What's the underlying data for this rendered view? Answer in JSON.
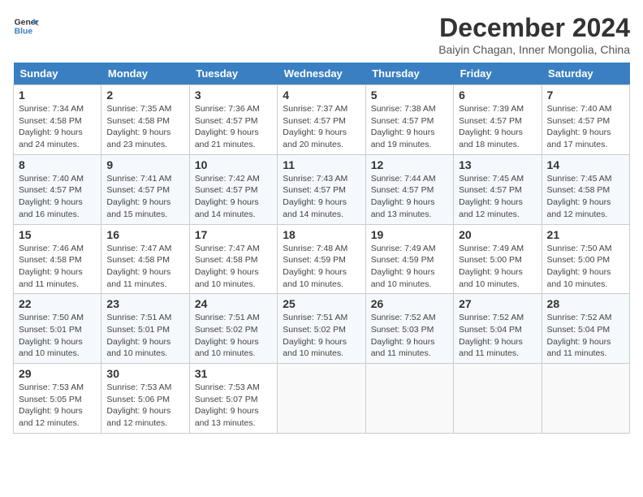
{
  "logo": {
    "line1": "General",
    "line2": "Blue"
  },
  "title": "December 2024",
  "subtitle": "Baiyin Chagan, Inner Mongolia, China",
  "days_of_week": [
    "Sunday",
    "Monday",
    "Tuesday",
    "Wednesday",
    "Thursday",
    "Friday",
    "Saturday"
  ],
  "weeks": [
    [
      {
        "day": 1,
        "sunrise": "Sunrise: 7:34 AM",
        "sunset": "Sunset: 4:58 PM",
        "daylight": "Daylight: 9 hours and 24 minutes."
      },
      {
        "day": 2,
        "sunrise": "Sunrise: 7:35 AM",
        "sunset": "Sunset: 4:58 PM",
        "daylight": "Daylight: 9 hours and 23 minutes."
      },
      {
        "day": 3,
        "sunrise": "Sunrise: 7:36 AM",
        "sunset": "Sunset: 4:57 PM",
        "daylight": "Daylight: 9 hours and 21 minutes."
      },
      {
        "day": 4,
        "sunrise": "Sunrise: 7:37 AM",
        "sunset": "Sunset: 4:57 PM",
        "daylight": "Daylight: 9 hours and 20 minutes."
      },
      {
        "day": 5,
        "sunrise": "Sunrise: 7:38 AM",
        "sunset": "Sunset: 4:57 PM",
        "daylight": "Daylight: 9 hours and 19 minutes."
      },
      {
        "day": 6,
        "sunrise": "Sunrise: 7:39 AM",
        "sunset": "Sunset: 4:57 PM",
        "daylight": "Daylight: 9 hours and 18 minutes."
      },
      {
        "day": 7,
        "sunrise": "Sunrise: 7:40 AM",
        "sunset": "Sunset: 4:57 PM",
        "daylight": "Daylight: 9 hours and 17 minutes."
      }
    ],
    [
      {
        "day": 8,
        "sunrise": "Sunrise: 7:40 AM",
        "sunset": "Sunset: 4:57 PM",
        "daylight": "Daylight: 9 hours and 16 minutes."
      },
      {
        "day": 9,
        "sunrise": "Sunrise: 7:41 AM",
        "sunset": "Sunset: 4:57 PM",
        "daylight": "Daylight: 9 hours and 15 minutes."
      },
      {
        "day": 10,
        "sunrise": "Sunrise: 7:42 AM",
        "sunset": "Sunset: 4:57 PM",
        "daylight": "Daylight: 9 hours and 14 minutes."
      },
      {
        "day": 11,
        "sunrise": "Sunrise: 7:43 AM",
        "sunset": "Sunset: 4:57 PM",
        "daylight": "Daylight: 9 hours and 14 minutes."
      },
      {
        "day": 12,
        "sunrise": "Sunrise: 7:44 AM",
        "sunset": "Sunset: 4:57 PM",
        "daylight": "Daylight: 9 hours and 13 minutes."
      },
      {
        "day": 13,
        "sunrise": "Sunrise: 7:45 AM",
        "sunset": "Sunset: 4:57 PM",
        "daylight": "Daylight: 9 hours and 12 minutes."
      },
      {
        "day": 14,
        "sunrise": "Sunrise: 7:45 AM",
        "sunset": "Sunset: 4:58 PM",
        "daylight": "Daylight: 9 hours and 12 minutes."
      }
    ],
    [
      {
        "day": 15,
        "sunrise": "Sunrise: 7:46 AM",
        "sunset": "Sunset: 4:58 PM",
        "daylight": "Daylight: 9 hours and 11 minutes."
      },
      {
        "day": 16,
        "sunrise": "Sunrise: 7:47 AM",
        "sunset": "Sunset: 4:58 PM",
        "daylight": "Daylight: 9 hours and 11 minutes."
      },
      {
        "day": 17,
        "sunrise": "Sunrise: 7:47 AM",
        "sunset": "Sunset: 4:58 PM",
        "daylight": "Daylight: 9 hours and 10 minutes."
      },
      {
        "day": 18,
        "sunrise": "Sunrise: 7:48 AM",
        "sunset": "Sunset: 4:59 PM",
        "daylight": "Daylight: 9 hours and 10 minutes."
      },
      {
        "day": 19,
        "sunrise": "Sunrise: 7:49 AM",
        "sunset": "Sunset: 4:59 PM",
        "daylight": "Daylight: 9 hours and 10 minutes."
      },
      {
        "day": 20,
        "sunrise": "Sunrise: 7:49 AM",
        "sunset": "Sunset: 5:00 PM",
        "daylight": "Daylight: 9 hours and 10 minutes."
      },
      {
        "day": 21,
        "sunrise": "Sunrise: 7:50 AM",
        "sunset": "Sunset: 5:00 PM",
        "daylight": "Daylight: 9 hours and 10 minutes."
      }
    ],
    [
      {
        "day": 22,
        "sunrise": "Sunrise: 7:50 AM",
        "sunset": "Sunset: 5:01 PM",
        "daylight": "Daylight: 9 hours and 10 minutes."
      },
      {
        "day": 23,
        "sunrise": "Sunrise: 7:51 AM",
        "sunset": "Sunset: 5:01 PM",
        "daylight": "Daylight: 9 hours and 10 minutes."
      },
      {
        "day": 24,
        "sunrise": "Sunrise: 7:51 AM",
        "sunset": "Sunset: 5:02 PM",
        "daylight": "Daylight: 9 hours and 10 minutes."
      },
      {
        "day": 25,
        "sunrise": "Sunrise: 7:51 AM",
        "sunset": "Sunset: 5:02 PM",
        "daylight": "Daylight: 9 hours and 10 minutes."
      },
      {
        "day": 26,
        "sunrise": "Sunrise: 7:52 AM",
        "sunset": "Sunset: 5:03 PM",
        "daylight": "Daylight: 9 hours and 11 minutes."
      },
      {
        "day": 27,
        "sunrise": "Sunrise: 7:52 AM",
        "sunset": "Sunset: 5:04 PM",
        "daylight": "Daylight: 9 hours and 11 minutes."
      },
      {
        "day": 28,
        "sunrise": "Sunrise: 7:52 AM",
        "sunset": "Sunset: 5:04 PM",
        "daylight": "Daylight: 9 hours and 11 minutes."
      }
    ],
    [
      {
        "day": 29,
        "sunrise": "Sunrise: 7:53 AM",
        "sunset": "Sunset: 5:05 PM",
        "daylight": "Daylight: 9 hours and 12 minutes."
      },
      {
        "day": 30,
        "sunrise": "Sunrise: 7:53 AM",
        "sunset": "Sunset: 5:06 PM",
        "daylight": "Daylight: 9 hours and 12 minutes."
      },
      {
        "day": 31,
        "sunrise": "Sunrise: 7:53 AM",
        "sunset": "Sunset: 5:07 PM",
        "daylight": "Daylight: 9 hours and 13 minutes."
      },
      null,
      null,
      null,
      null
    ]
  ]
}
